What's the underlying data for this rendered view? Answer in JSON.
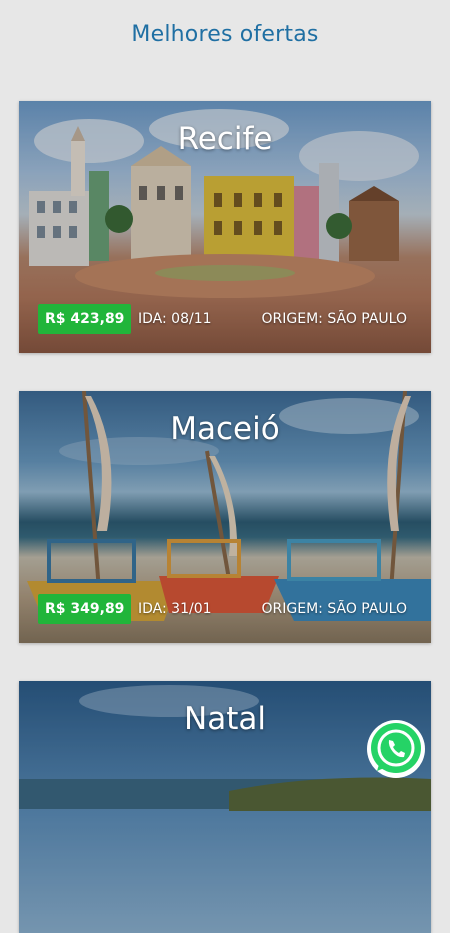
{
  "header": {
    "title": "Melhores ofertas"
  },
  "offers": [
    {
      "city": "Recife",
      "price": "R$ 423,89",
      "date": "IDA: 08/11",
      "origin": "ORIGEM: SÃO PAULO"
    },
    {
      "city": "Maceió",
      "price": "R$ 349,89",
      "date": "IDA: 31/01",
      "origin": "ORIGEM: SÃO PAULO"
    },
    {
      "city": "Natal"
    }
  ],
  "colors": {
    "title": "#1f6fa3",
    "price_badge": "#21b53a",
    "background": "#e7e7e7",
    "whatsapp": "#25d366"
  },
  "icons": {
    "chat": "whatsapp-icon"
  }
}
